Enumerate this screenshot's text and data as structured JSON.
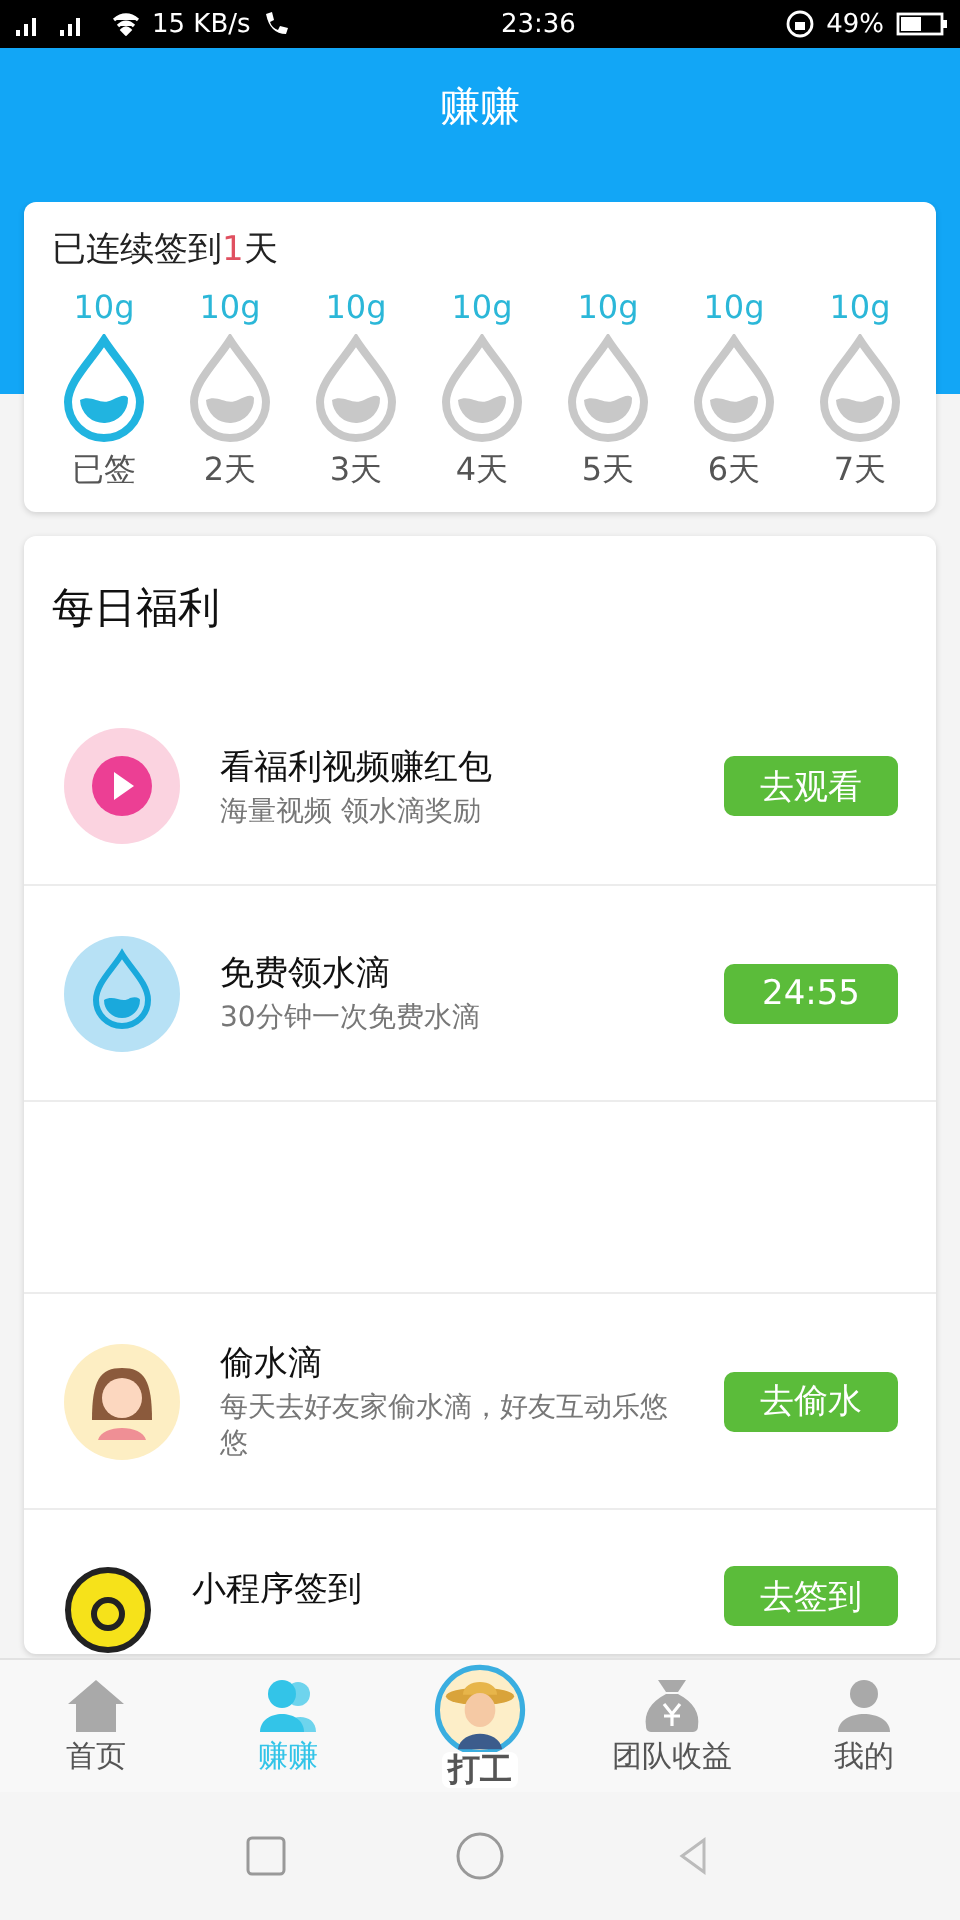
{
  "status_bar": {
    "speed": "15 KB/s",
    "time": "23:36",
    "battery": "49%"
  },
  "header": {
    "title": "赚赚"
  },
  "checkin": {
    "prefix": "已连续签到",
    "count": "1",
    "suffix": "天",
    "days": [
      {
        "reward": "10g",
        "label": "已签",
        "signed": true
      },
      {
        "reward": "10g",
        "label": "2天",
        "signed": false
      },
      {
        "reward": "10g",
        "label": "3天",
        "signed": false
      },
      {
        "reward": "10g",
        "label": "4天",
        "signed": false
      },
      {
        "reward": "10g",
        "label": "5天",
        "signed": false
      },
      {
        "reward": "10g",
        "label": "6天",
        "signed": false
      },
      {
        "reward": "10g",
        "label": "7天",
        "signed": false
      }
    ]
  },
  "welfare": {
    "title": "每日福利",
    "tasks": [
      {
        "kind": "video",
        "title": "看福利视频赚红包",
        "subtitle": "海量视频 领水滴奖励",
        "action": "去观看"
      },
      {
        "kind": "drop",
        "title": "免费领水滴",
        "subtitle": "30分钟一次免费水滴",
        "action": "24:55"
      },
      {
        "kind": "blank"
      },
      {
        "kind": "friend",
        "title": "偷水滴",
        "subtitle": "每天去好友家偷水滴，好友互动乐悠悠",
        "action": "去偷水"
      },
      {
        "kind": "coin",
        "title": "小程序签到",
        "action": "去签到"
      }
    ]
  },
  "tab_bar": [
    {
      "kind": "home",
      "label": "首页",
      "selected": false
    },
    {
      "kind": "people",
      "label": "赚赚",
      "selected": true
    },
    {
      "kind": "avatar",
      "label": "打工",
      "selected": false
    },
    {
      "kind": "moneybag",
      "label": "团队收益",
      "selected": false
    },
    {
      "kind": "person",
      "label": "我的",
      "selected": false
    }
  ]
}
